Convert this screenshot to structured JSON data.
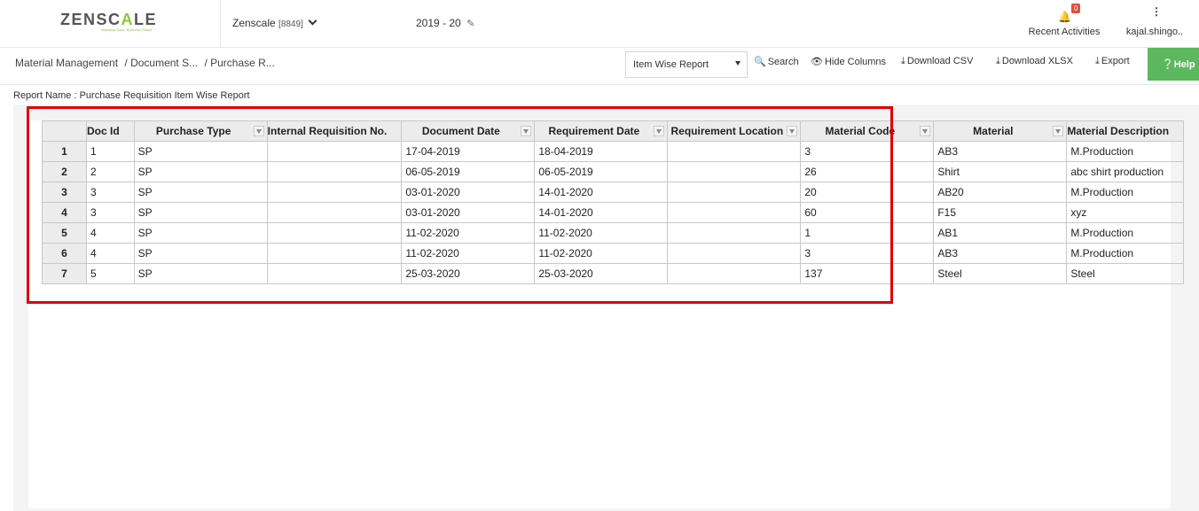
{
  "header": {
    "logo": {
      "part1": "ZENSC",
      "accent": "A",
      "part2": "LE"
    },
    "tagline": "Business Ease. Business Peace.",
    "company_name": "Zenscale",
    "company_code": "[8849]",
    "year": "2019 - 20",
    "notifications_count": "0",
    "recent_activities_label": "Recent Activities",
    "username": "kajal.shingo.."
  },
  "breadcrumb": [
    "Material Management",
    "/ Document S...",
    "/ Purchase R..."
  ],
  "toolbar": {
    "report_select_value": "Item Wise Report",
    "search_label": "Search",
    "hide_columns_label": "Hide Columns",
    "download_csv_label": "Download CSV",
    "download_xlsx_label": "Download XLSX",
    "export_label": "Export",
    "help_label": "Help"
  },
  "report_name": "Report Name : Purchase Requisition Item Wise Report",
  "table": {
    "columns": [
      "",
      "Doc Id",
      "Purchase Type",
      "Internal Requisition No.",
      "Document Date",
      "Requirement Date",
      "Requirement Location",
      "Material Code",
      "Material",
      "Material Description"
    ],
    "rows": [
      [
        "1",
        "1",
        "SP",
        "",
        "17-04-2019",
        "18-04-2019",
        "",
        "3",
        "AB3",
        "M.Production"
      ],
      [
        "2",
        "2",
        "SP",
        "",
        "06-05-2019",
        "06-05-2019",
        "",
        "26",
        "Shirt",
        "abc shirt production"
      ],
      [
        "3",
        "3",
        "SP",
        "",
        "03-01-2020",
        "14-01-2020",
        "",
        "20",
        "AB20",
        "M.Production"
      ],
      [
        "4",
        "3",
        "SP",
        "",
        "03-01-2020",
        "14-01-2020",
        "",
        "60",
        "F15",
        "xyz"
      ],
      [
        "5",
        "4",
        "SP",
        "",
        "11-02-2020",
        "11-02-2020",
        "",
        "1",
        "AB1",
        "M.Production"
      ],
      [
        "6",
        "4",
        "SP",
        "",
        "11-02-2020",
        "11-02-2020",
        "",
        "3",
        "AB3",
        "M.Production"
      ],
      [
        "7",
        "5",
        "SP",
        "",
        "25-03-2020",
        "25-03-2020",
        "",
        "137",
        "Steel",
        "Steel"
      ]
    ]
  },
  "colors": {
    "accent_green": "#8dc63f",
    "help_bg": "#5cb85c",
    "highlight_border": "#e00000",
    "badge": "#e74c3c"
  }
}
